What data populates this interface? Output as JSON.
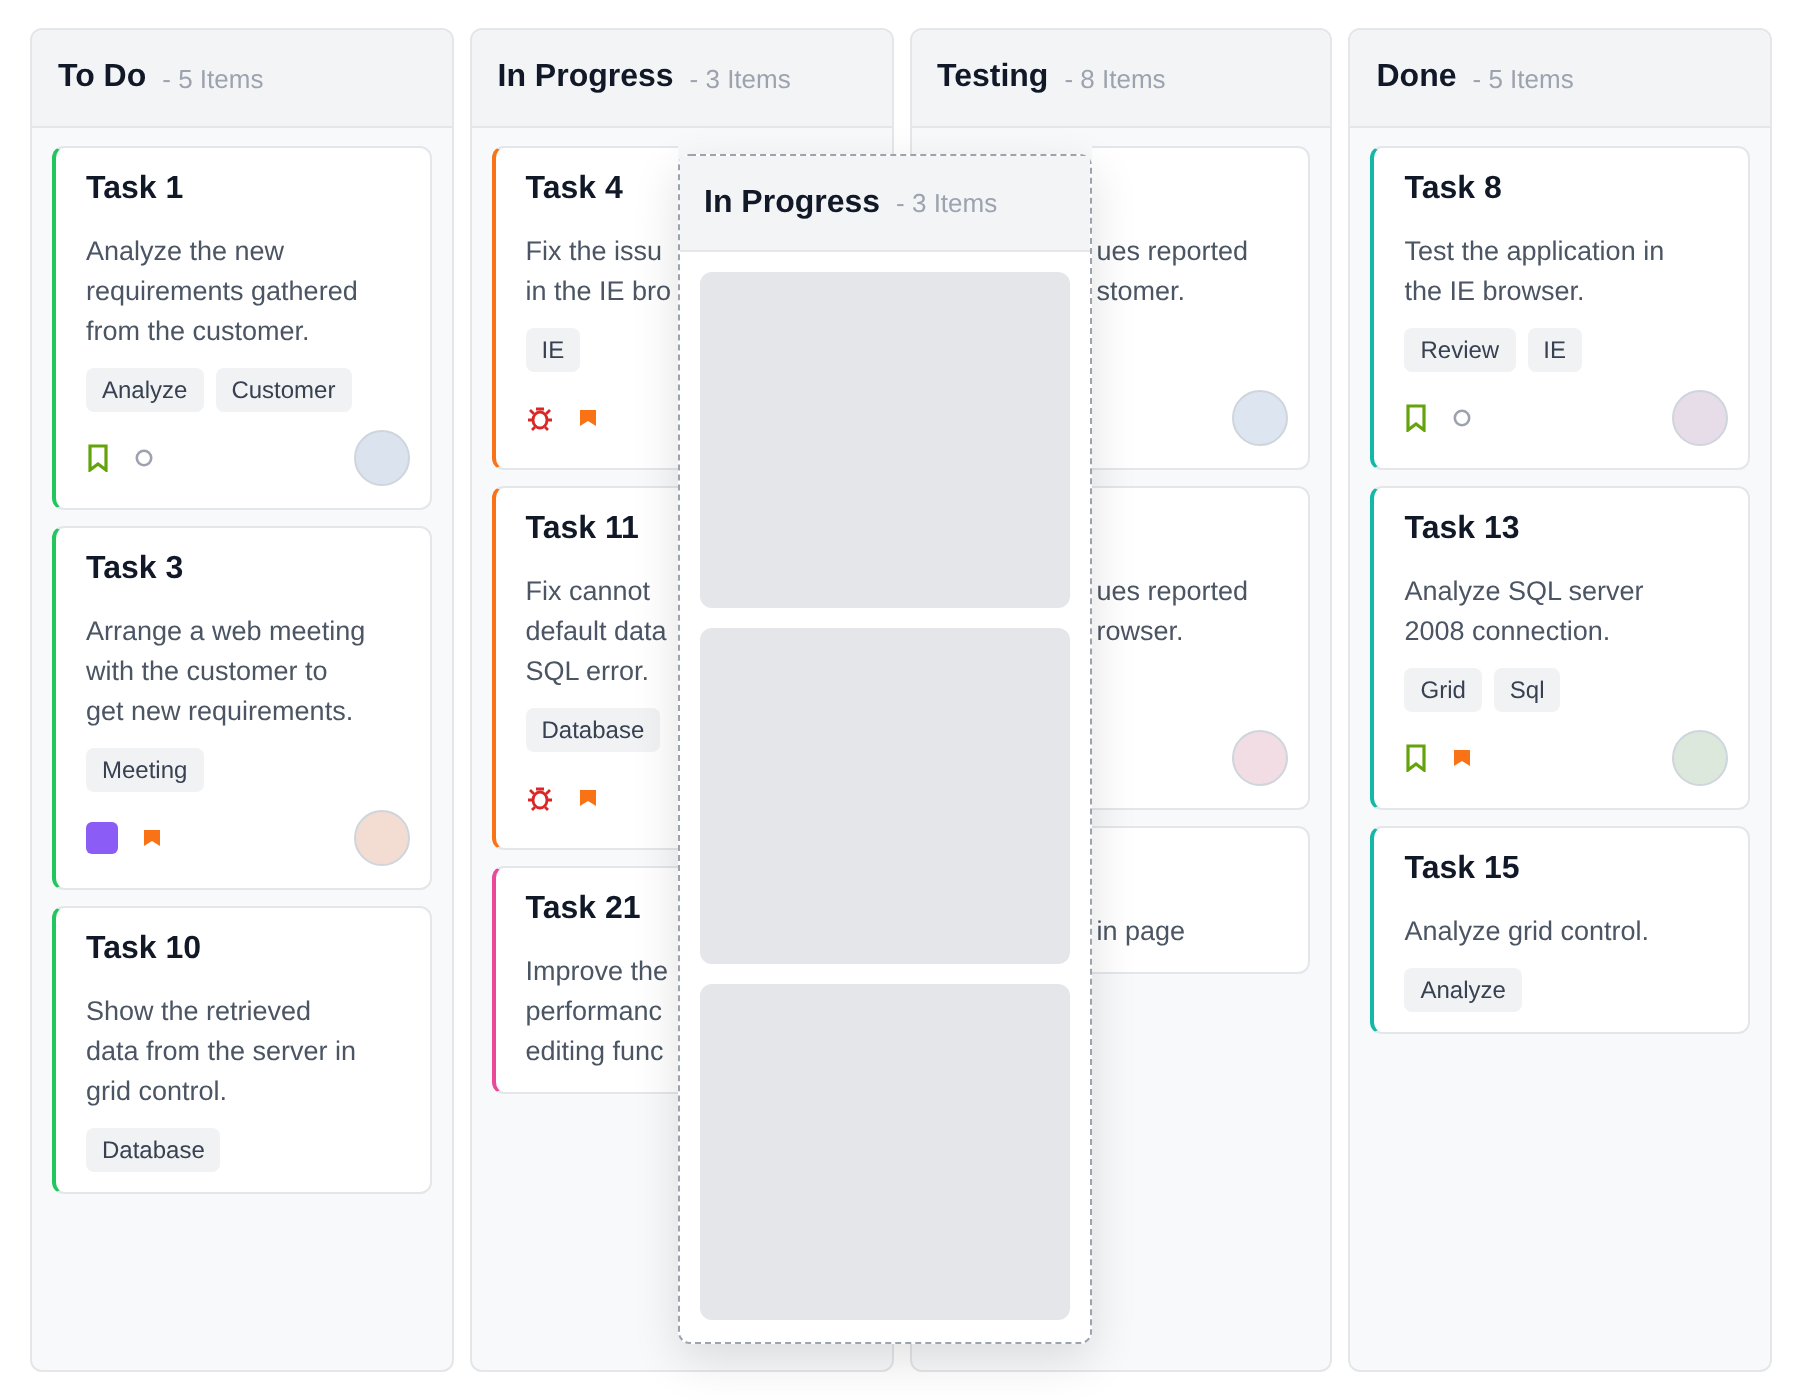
{
  "columns": [
    {
      "title": "To Do",
      "count": "- 5 Items",
      "cards": [
        {
          "title": "Task 1",
          "color": "#22c55e",
          "lines": [
            "Analyze the new",
            "requirements gathered",
            "from the customer."
          ],
          "tags": [
            "Analyze",
            "Customer"
          ],
          "icons": [
            {
              "kind": "bookmark"
            },
            {
              "kind": "circle"
            }
          ],
          "avatar": {
            "color": "#dbe3ef"
          }
        },
        {
          "title": "Task 3",
          "color": "#22c55e",
          "lines": [
            "Arrange a web meeting",
            "with the customer to",
            "get new requirements."
          ],
          "tags": [
            "Meeting"
          ],
          "icons": [
            {
              "kind": "square"
            },
            {
              "kind": "flag"
            }
          ],
          "avatar": {
            "color": "#f3ddd2"
          }
        },
        {
          "title": "Task 10",
          "color": "#22c55e",
          "lines": [
            "Show the retrieved",
            "data from the server in",
            "grid control."
          ],
          "tags": [
            "Database"
          ]
        }
      ]
    },
    {
      "title": "In Progress",
      "count": "- 3 Items",
      "cards": [
        {
          "title": "Task 4",
          "color": "#f97316",
          "lines": [
            "Fix the issu",
            "in the IE bro"
          ],
          "tags": [
            "IE"
          ],
          "icons": [
            {
              "kind": "bug"
            },
            {
              "kind": "flag"
            }
          ]
        },
        {
          "title": "Task 11",
          "color": "#f97316",
          "lines": [
            "Fix cannot",
            "default data",
            "SQL error."
          ],
          "tags": [
            "Database"
          ],
          "icons": [
            {
              "kind": "bug"
            },
            {
              "kind": "flag"
            }
          ]
        },
        {
          "title": "Task 21",
          "color": "#ec4899",
          "lines": [
            "Improve the",
            "performanc",
            "editing func"
          ]
        }
      ]
    },
    {
      "title": "Testing",
      "count": "- 8 Items",
      "cards": [
        {
          "lines": [
            "ues reported",
            "stomer."
          ],
          "avatar": {
            "color": "#dce5f0"
          }
        },
        {
          "lines": [
            "ues reported",
            "rowser."
          ],
          "avatar": {
            "color": "#f1dde3"
          }
        },
        {
          "lines": [
            "in page"
          ]
        }
      ]
    },
    {
      "title": "Done",
      "count": "- 5 Items",
      "cards": [
        {
          "title": "Task 8",
          "color": "#14b8a6",
          "lines": [
            "Test the application in",
            "the IE browser."
          ],
          "tags": [
            "Review",
            "IE"
          ],
          "icons": [
            {
              "kind": "bookmark"
            },
            {
              "kind": "circle"
            }
          ],
          "avatar": {
            "color": "#e6dde9"
          }
        },
        {
          "title": "Task 13",
          "color": "#14b8a6",
          "lines": [
            "Analyze SQL server",
            "2008 connection."
          ],
          "tags": [
            "Grid",
            "Sql"
          ],
          "icons": [
            {
              "kind": "bookmark"
            },
            {
              "kind": "flag"
            }
          ],
          "avatar": {
            "color": "#dde8dd"
          }
        },
        {
          "title": "Task 15",
          "color": "#14b8a6",
          "lines": [
            "Analyze grid control."
          ],
          "tags": [
            "Analyze"
          ]
        }
      ]
    }
  ],
  "drag_preview": {
    "title": "In Progress",
    "count": "- 3 Items",
    "cards": [
      {
        "kind": "skeleton"
      },
      {
        "kind": "skeleton"
      },
      {
        "kind": "skeleton"
      }
    ]
  }
}
